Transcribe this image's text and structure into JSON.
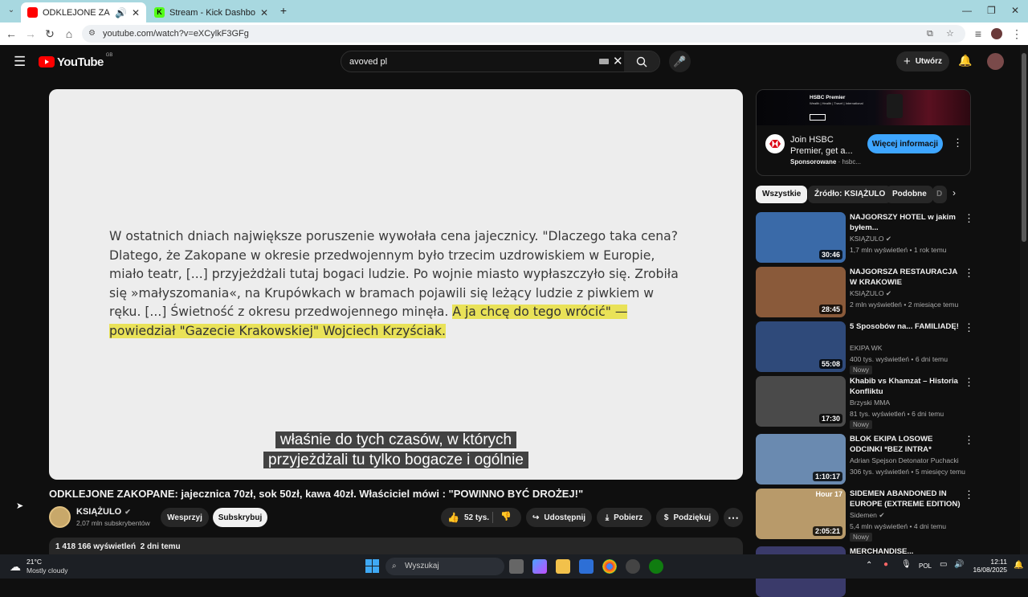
{
  "browser": {
    "tabs": [
      {
        "title": "ODKLEJONE ZAKOPANE: ja",
        "active": true,
        "favicon_color": "#ff0000"
      },
      {
        "title": "Stream - Kick Dashboard",
        "active": false,
        "favicon_color": "#53fc18"
      }
    ],
    "new_tab_icon": "plus-icon",
    "url": "youtube.com/watch?v=eXCylkF3GFg"
  },
  "youtube": {
    "logo_text": "YouTube",
    "region": "GB",
    "search": {
      "value": "avoved pl"
    },
    "create_label": "Utwórz",
    "player": {
      "quote_plain": "W ostatnich dniach największe poruszenie wywołała cena jajecznicy. \"Dlaczego taka cena? Dlatego, że Zakopane w okresie przedwojennym było trzecim uzdrowiskiem w Europie, miało teatr, [...] przyjeżdżali tutaj bogaci ludzie. Po wojnie miasto wypłaszczyło się. Zrobiła się »małyszomania«, na Krupówkach w bramach pojawili się leżący ludzie z piwkiem w ręku. [...] Świetność z okresu przedwojennego minęła.",
      "quote_highlight": "A ja chcę do tego wrócić\" — powiedział \"Gazecie Krakowskiej\" Wojciech Krzyściak.",
      "caption_line1": "właśnie do tych czasów, w których",
      "caption_line2": "przyjeżdżali tu tylko bogacze i ogólnie"
    },
    "video_title": "ODKLEJONE ZAKOPANE: jajecznica 70zł, sok 50zł, kawa 40zł. Właściciel mówi : \"POWINNO BYĆ DROŻEJ!\"",
    "channel": {
      "name": "KSIĄŻULO",
      "subscribers": "2,07 mln subskrybentów"
    },
    "actions": {
      "support": "Wesprzyj",
      "subscribe": "Subskrybuj",
      "likes": "52 tys.",
      "share": "Udostępnij",
      "download": "Pobierz",
      "thanks": "Podziękuj"
    },
    "description": {
      "views": "1 418 166 wyświetleń",
      "age": "2 dni temu"
    },
    "ad": {
      "banner_title": "HSBC Premier",
      "banner_sub": "Wealth | Health | Travel | International",
      "title": "Join HSBC Premier, get a...",
      "sponsored": "Sponsorowane",
      "domain": "hsbc...",
      "cta": "Więcej informacji"
    },
    "chips": [
      "Wszystkie",
      "Źródło: KSIĄŻULO",
      "Podobne",
      "D"
    ],
    "recommendations": [
      {
        "title": "NAJGORSZY HOTEL w jakim byłem...",
        "channel": "KSIĄŻULO",
        "verified": true,
        "views": "1,7 mln wyświetleń",
        "age": "1 rok temu",
        "duration": "30:46",
        "badge": "",
        "thumb_color": "#3a6aa8"
      },
      {
        "title": "NAJGORSZA RESTAURACJA W KRAKOWIE",
        "channel": "KSIĄŻULO",
        "verified": true,
        "views": "2 mln wyświetleń",
        "age": "2 miesiące temu",
        "duration": "28:45",
        "badge": "",
        "thumb_color": "#8a5a3a"
      },
      {
        "title": "5 Sposobów na... FAMILIADĘ!",
        "channel": "EKIPA WK",
        "verified": false,
        "views": "400 tys. wyświetleń",
        "age": "6 dni temu",
        "duration": "55:08",
        "badge": "Nowy",
        "thumb_color": "#2f4a7a"
      },
      {
        "title": "Khabib vs Khamzat – Historia Konfliktu",
        "channel": "Brzyski MMA",
        "verified": false,
        "views": "81 tys. wyświetleń",
        "age": "6 dni temu",
        "duration": "17:30",
        "badge": "Nowy",
        "thumb_color": "#4a4a4a"
      },
      {
        "title": "BLOK EKIPA LOSOWE ODCINKI *BEZ INTRA*",
        "channel": "Adrian Spejson Detonator Puchacki",
        "verified": false,
        "views": "306 tys. wyświetleń",
        "age": "5 miesięcy temu",
        "duration": "1:10:17",
        "badge": "",
        "thumb_color": "#6a8ab0"
      },
      {
        "title": "SIDEMEN ABANDONED IN EUROPE (EXTREME EDITION)",
        "channel": "Sidemen",
        "verified": true,
        "views": "5,4 mln wyświetleń",
        "age": "4 dni temu",
        "duration": "2:05:21",
        "badge": "Nowy",
        "thumb_color": "#b89a6a",
        "thumb_text": "Hour 17"
      },
      {
        "title": "MERCHANDISE...",
        "channel": "",
        "verified": false,
        "views": "",
        "age": "",
        "duration": "",
        "badge": "",
        "thumb_color": "#3a3a6a"
      }
    ]
  },
  "taskbar": {
    "weather_temp": "21°C",
    "weather_desc": "Mostly cloudy",
    "search_placeholder": "Wyszukaj",
    "language": "POL",
    "time": "12:11",
    "date": "16/08/2025"
  },
  "colors": {
    "yt_red": "#ff0000",
    "cta_blue": "#3ea6ff",
    "highlight": "#e9e258"
  }
}
